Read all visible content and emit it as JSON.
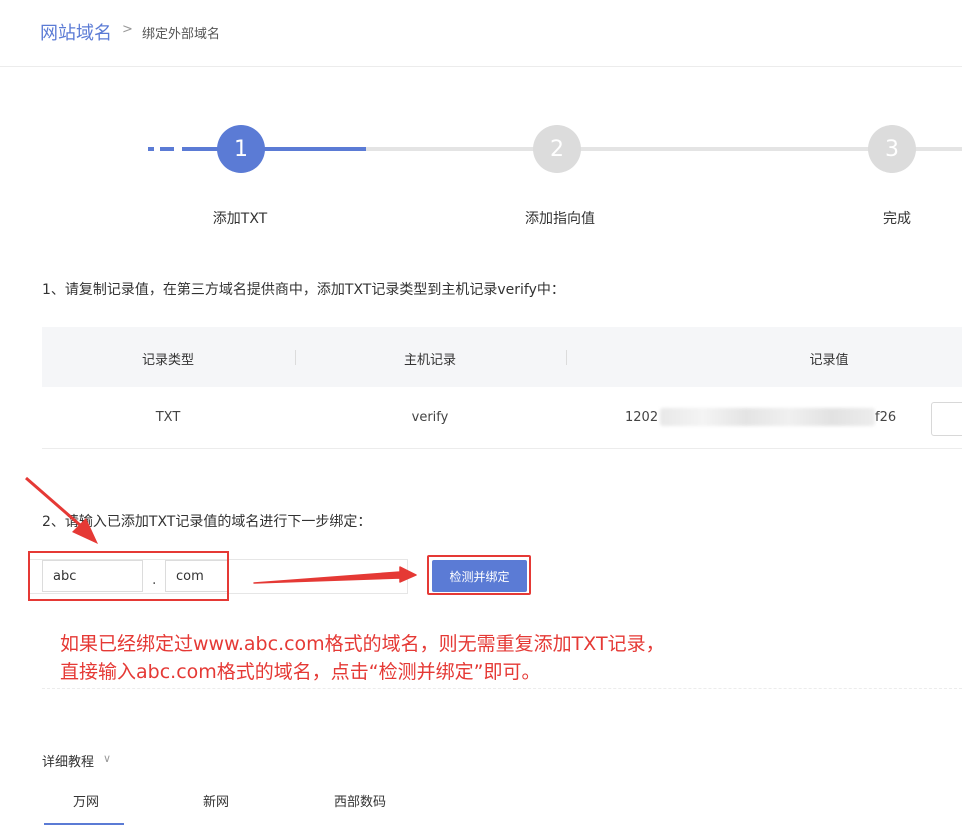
{
  "breadcrumb": {
    "root": "网站域名",
    "separator": ">",
    "current": "绑定外部域名"
  },
  "steps": [
    {
      "number": "1",
      "label": "添加TXT",
      "state": "active"
    },
    {
      "number": "2",
      "label": "添加指向值",
      "state": "todo"
    },
    {
      "number": "3",
      "label": "完成",
      "state": "todo"
    }
  ],
  "step1_instruction": "1、请复制记录值，在第三方域名提供商中，添加TXT记录类型到主机记录verify中：",
  "table": {
    "headers": [
      "记录类型",
      "主机记录",
      "记录值"
    ],
    "row": {
      "type": "TXT",
      "host": "verify",
      "value_start": "1202",
      "value_end": "f26"
    }
  },
  "step2_instruction": "2、请输入已添加TXT记录值的域名进行下一步绑定：",
  "domain_input": {
    "name_value": "abc",
    "dot": ".",
    "suffix_value": "com"
  },
  "bind_button": "检测并绑定",
  "annotation": {
    "line1": "如果已经绑定过www.abc.com格式的域名，则无需重复添加TXT记录，",
    "line2": "直接输入abc.com格式的域名，点击“检测并绑定”即可。"
  },
  "tutorial": {
    "title": "详细教程",
    "chevron_icon": "chevron-down-icon",
    "tabs": [
      "万网",
      "新网",
      "西部数码"
    ]
  },
  "colors": {
    "accent": "#5b7bd5",
    "annotation_red": "#e53935",
    "inactive_step": "#dcdcdc"
  }
}
